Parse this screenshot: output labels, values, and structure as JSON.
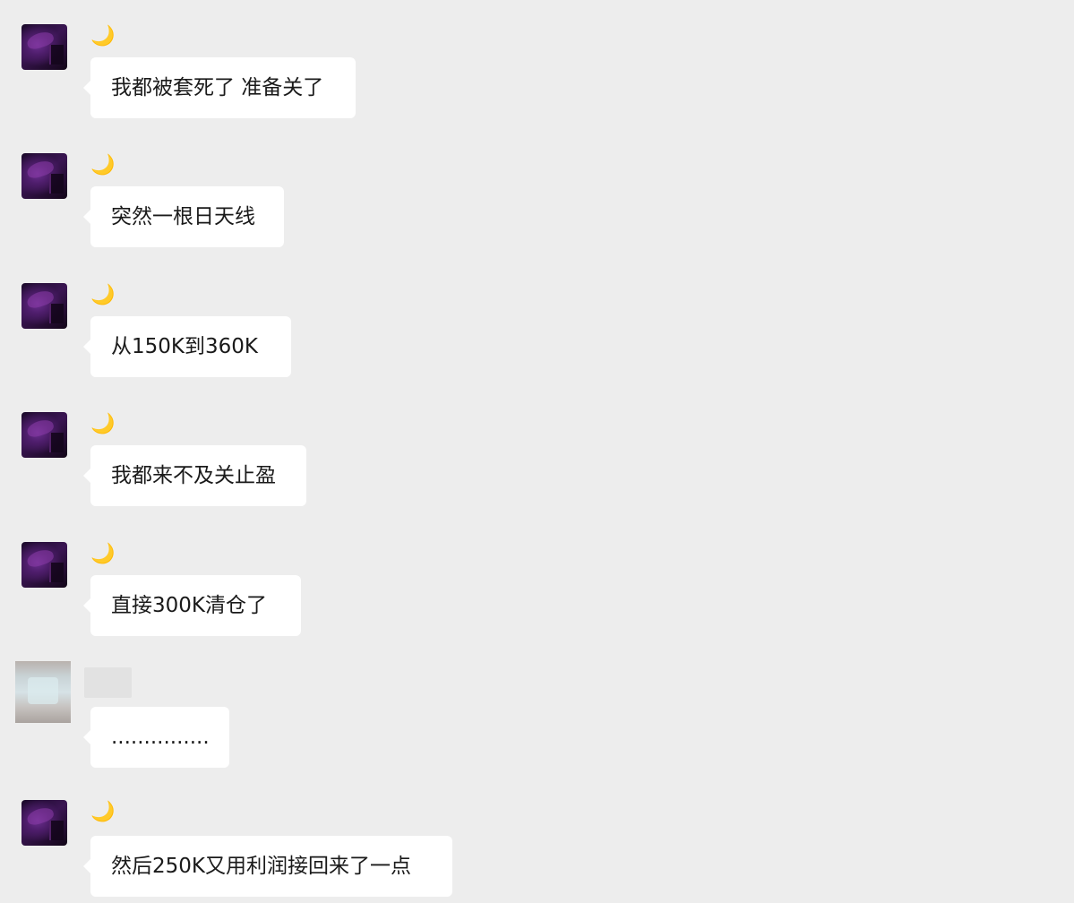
{
  "accent_colors": {
    "background": "#ededed",
    "bubble": "#ffffff",
    "text": "#1a1a1a",
    "nickname": "#e8b82c"
  },
  "messages": [
    {
      "sender": "🌙",
      "avatar": "dark-avatar-icon",
      "text": "我都被套死了 准备关了"
    },
    {
      "sender": "🌙",
      "avatar": "dark-avatar-icon",
      "text": "突然一根日天线"
    },
    {
      "sender": "🌙",
      "avatar": "dark-avatar-icon",
      "text": "从150K到360K"
    },
    {
      "sender": "🌙",
      "avatar": "dark-avatar-icon",
      "text": "我都来不及关止盈"
    },
    {
      "sender": "🌙",
      "avatar": "dark-avatar-icon",
      "text": "直接300K清仓了"
    },
    {
      "sender": "",
      "avatar": "blurred-avatar-icon",
      "text": "..............."
    },
    {
      "sender": "🌙",
      "avatar": "dark-avatar-icon",
      "text": "然后250K又用利润接回来了一点"
    }
  ]
}
